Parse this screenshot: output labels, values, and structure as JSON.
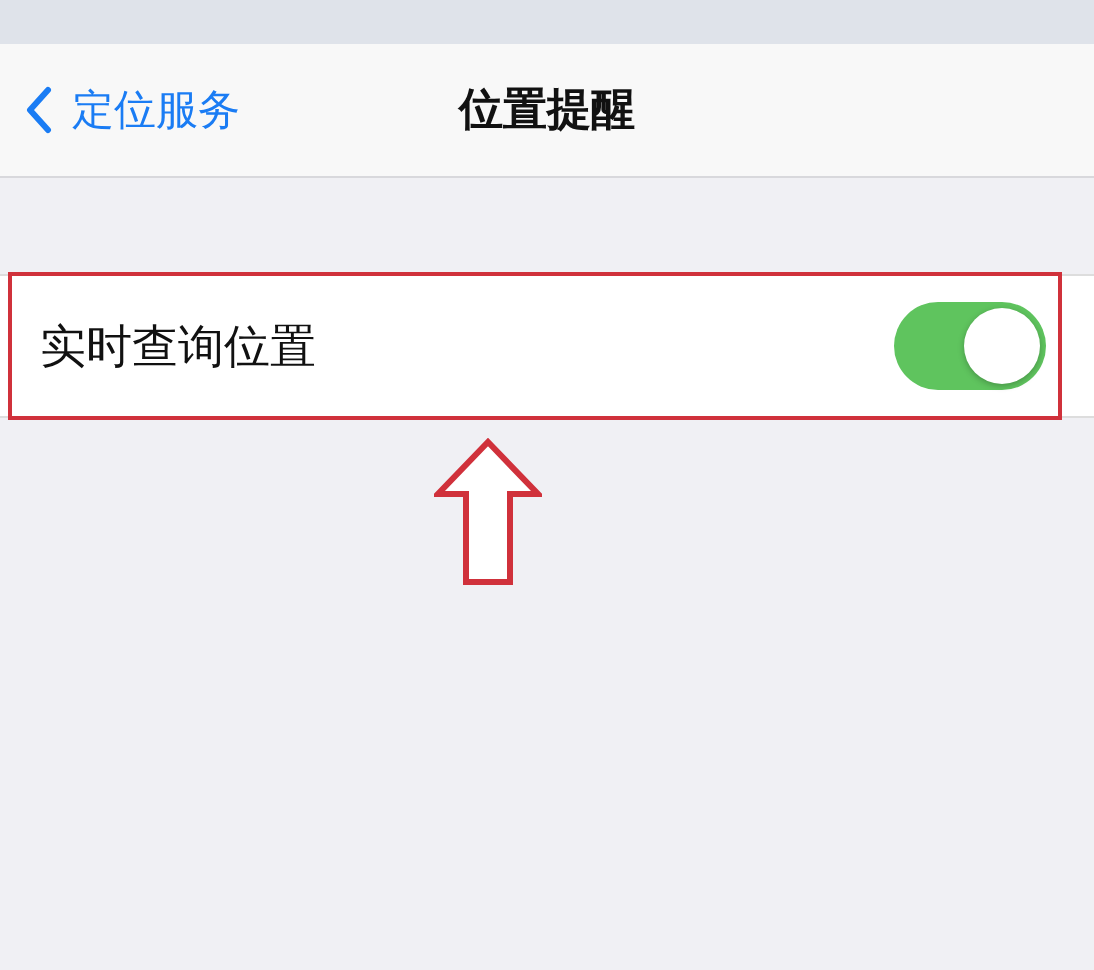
{
  "nav_bar": {
    "back_label": "定位服务",
    "title": "位置提醒"
  },
  "settings": [
    {
      "label": "实时查询位置",
      "on": true,
      "highlighted": true
    }
  ]
}
